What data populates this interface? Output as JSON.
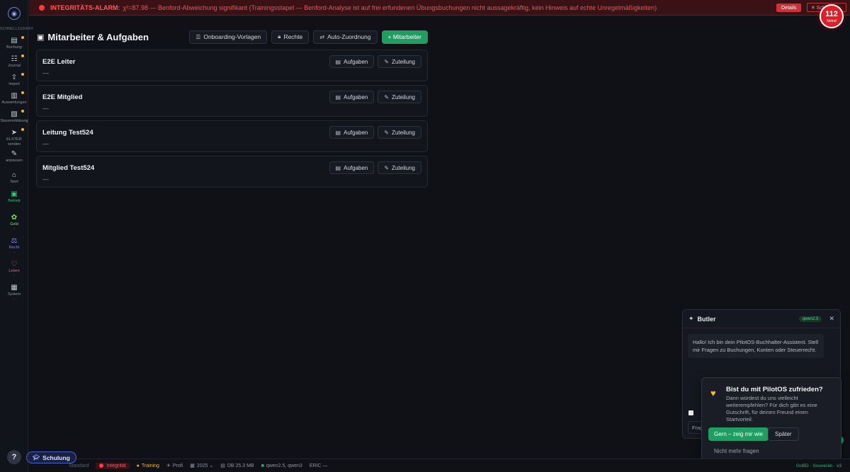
{
  "alarm": {
    "title": "INTEGRITÄTS-ALARM:",
    "detail": "χ²=87.98 — Benford-Abweichung signifikant (Trainingsstapel — Benford-Analyse ist auf frei erfundenen Übungsbuchungen nicht aussagekräftig, kein Hinweis auf echte Unregelmäßigkeiten)",
    "details_label": "Details",
    "close_label": "✕ Schließen"
  },
  "notruf": {
    "number": "112",
    "label": "Notruf"
  },
  "sidebar": {
    "group_label": "SCHNELLZUGRIFF",
    "quick": [
      {
        "icon": "▤",
        "label": "Buchung"
      },
      {
        "icon": "☷",
        "label": "Journal"
      },
      {
        "icon": "⇪",
        "label": "Import"
      },
      {
        "icon": "▥",
        "label": "Auswertungen"
      },
      {
        "icon": "▧",
        "label": "Steuererklärung"
      },
      {
        "icon": "➤",
        "label": "ELSTER senden"
      },
      {
        "icon": "✎",
        "label": "anpassen"
      }
    ],
    "sections": [
      {
        "icon": "⌂",
        "label": "Start"
      },
      {
        "icon": "▣",
        "label": "Betrieb"
      },
      {
        "icon": "✿",
        "label": "Geld",
        "sub": "›"
      },
      {
        "icon": "⚖",
        "label": "Recht",
        "sub": "›"
      },
      {
        "icon": "♡",
        "label": "Leben",
        "sub": "›"
      },
      {
        "icon": "▦",
        "label": "System",
        "sub": "›"
      }
    ],
    "help_label": "?"
  },
  "header": {
    "title": "Mitarbeiter & Aufgaben",
    "onboarding_label": "Onboarding-Vorlagen",
    "rights_label": "Rechte",
    "auto_label": "Auto-Zuordnung",
    "add_label": "+ Mitarbeiter"
  },
  "employees": [
    {
      "name": "E2E Leiter",
      "desc": "—"
    },
    {
      "name": "E2E Mitglied",
      "desc": "—"
    },
    {
      "name": "Leitung Test524",
      "desc": "—"
    },
    {
      "name": "Mitglied Test524",
      "desc": "—"
    }
  ],
  "card_actions": {
    "tasks_label": "Aufgaben",
    "assign_label": "Zuteilung"
  },
  "butler": {
    "title": "Butler",
    "model": "qwen2.5",
    "close": "✕",
    "message": "Hallo! Ich bin dein PilotOS-Buchhalter-Assistent. Stell mir Fragen zu Buchungen, Konten oder Steuerrecht.",
    "input_stub": "Frage"
  },
  "survey": {
    "question": "Bist du mit PilotOS zufrieden?",
    "body": "Dann würdest du uns vielleicht weiterempfehlen? Für dich gibt es eine Gutschrift, für deinen Freund einen Startvorteil.",
    "yes_label": "Gern – zeig mir wie",
    "later_label": "Später",
    "never_label": "Nicht mehr fragen"
  },
  "footer": {
    "mode": "Standard",
    "integrity": "Integrität",
    "training": "Training",
    "profile": "Profi",
    "year": "2025 ⌄",
    "db": "DB 25.3 MB",
    "models": "qwen2.5, qwen3",
    "eric": "ERIC —",
    "right": "GoBD · Souverän · v3"
  },
  "schulung_label": "Schulung"
}
